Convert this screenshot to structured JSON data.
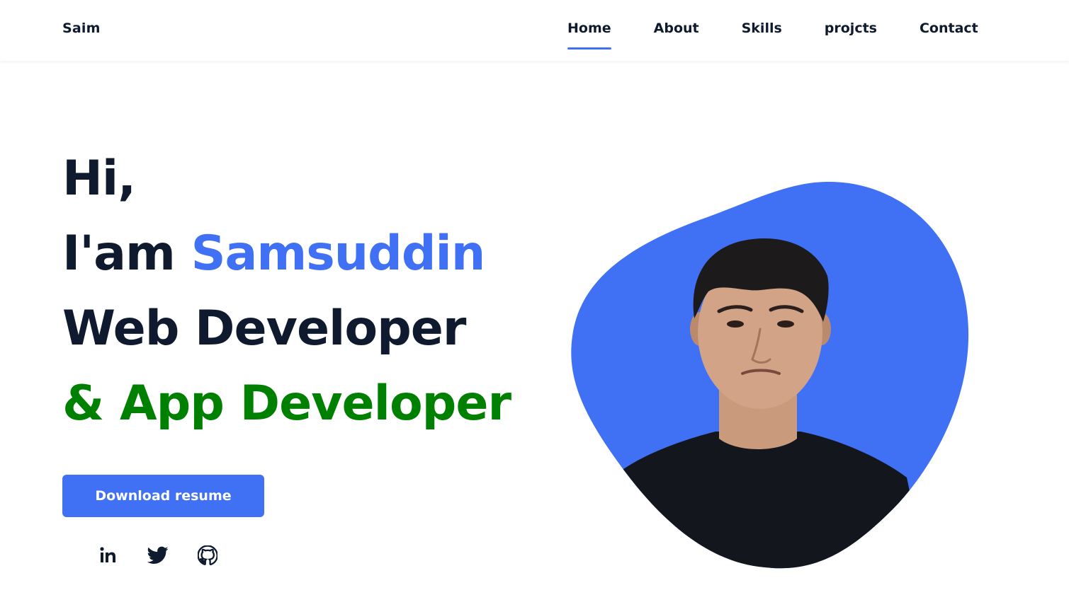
{
  "header": {
    "logo": "Saim",
    "nav": [
      "Home",
      "About",
      "Skills",
      "projcts",
      "Contact"
    ],
    "active": "Home"
  },
  "hero": {
    "line1": "Hi,",
    "line2_prefix": "I'am",
    "line2_name": "Samsuddin",
    "line3": "Web Developer",
    "line4": "& App Developer",
    "cta_label": "Download resume"
  },
  "socials": [
    {
      "icon": "linkedin-icon",
      "text": "in"
    },
    {
      "icon": "twitter-icon"
    },
    {
      "icon": "github-icon"
    }
  ],
  "colors": {
    "accent": "#4070f4",
    "green": "#008000",
    "text": "#0f1a2e"
  }
}
